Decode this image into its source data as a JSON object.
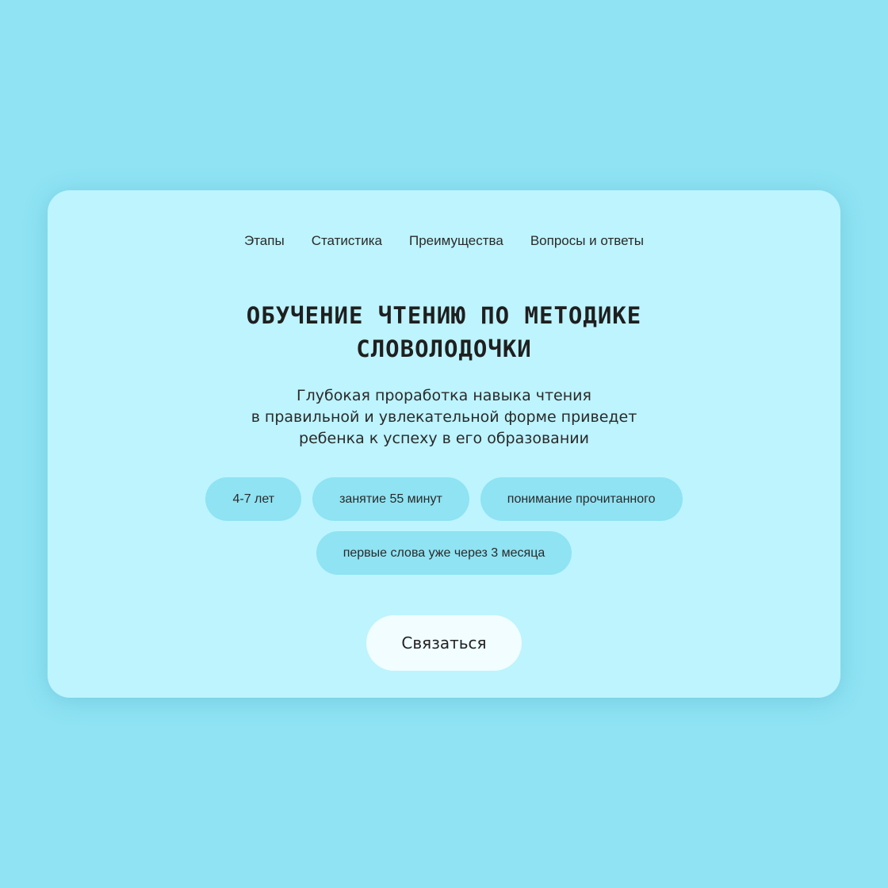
{
  "nav": {
    "items": [
      {
        "label": "Этапы"
      },
      {
        "label": "Статистика"
      },
      {
        "label": "Преимущества"
      },
      {
        "label": "Вопросы и ответы"
      }
    ]
  },
  "hero": {
    "title_line1": "ОБУЧЕНИЕ ЧТЕНИЮ ПО МЕТОДИКЕ",
    "title_line2": "СЛОВОЛОДОЧКИ",
    "subtitle_line1": "Глубокая проработка навыка чтения",
    "subtitle_line2": "в правильной и увлекательной форме приведет",
    "subtitle_line3": "ребенка к успеху в его образовании"
  },
  "tags": [
    {
      "label": "4-7 лет"
    },
    {
      "label": "занятие 55 минут"
    },
    {
      "label": "понимание прочитанного"
    },
    {
      "label": "первые слова уже через 3 месяца"
    }
  ],
  "cta": {
    "label": "Связаться"
  },
  "colors": {
    "background": "#8fe3f3",
    "card": "#bdf4fe",
    "tag": "#8fe3f3",
    "button": "#f1fdff"
  },
  "decor": {
    "icon": "open-book-icon"
  }
}
